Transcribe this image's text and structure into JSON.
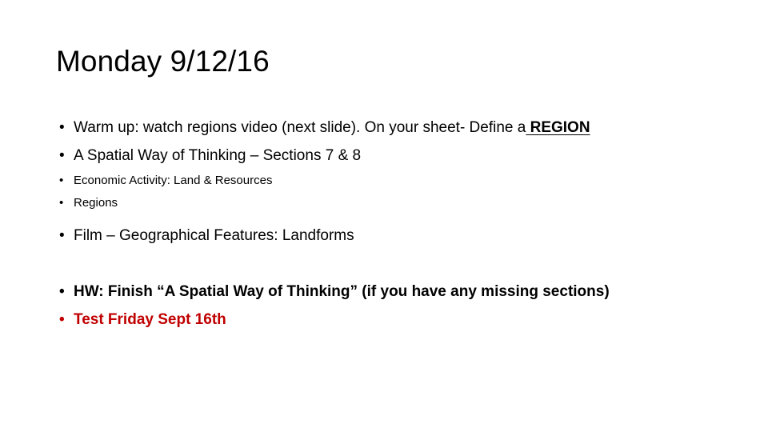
{
  "slide": {
    "title": "Monday 9/12/16",
    "background_color": "#FFFFFF",
    "text_color": "#000000",
    "accent_color": "#C00000",
    "bullet_glyph": "•",
    "content": {
      "warm_up": {
        "text_before": "Warm up: watch regions video (next slide). On your sheet- Define a",
        "emphasis": "REGION"
      },
      "spatial_way": "A Spatial Way of Thinking – Sections 7 & 8",
      "sub_items": [
        "Economic Activity:  Land & Resources",
        "Regions"
      ],
      "film": "Film – Geographical Features:  Landforms",
      "homework": "HW:  Finish “A Spatial Way of Thinking” (if you have any missing sections)",
      "test": "Test Friday Sept 16th"
    }
  }
}
